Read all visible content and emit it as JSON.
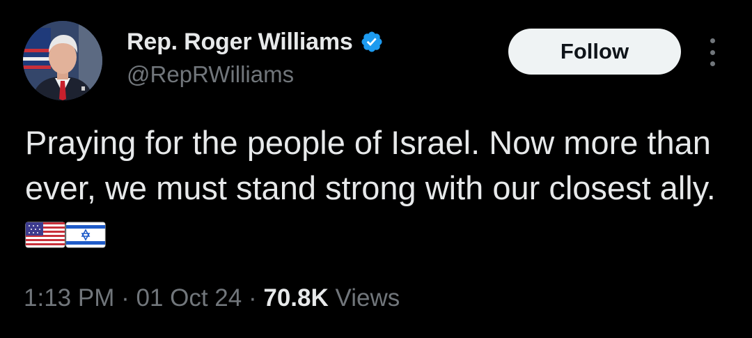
{
  "author": {
    "display_name": "Rep. Roger Williams",
    "handle": "@RepRWilliams",
    "verified_icon": "verified-badge-icon",
    "avatar_icon": "profile-photo"
  },
  "follow_button": {
    "label": "Follow"
  },
  "more_menu": {
    "icon": "more-vertical-icon"
  },
  "tweet": {
    "text": "Praying for the people of Israel. Now more than ever, we must stand strong with our closest ally.",
    "emojis": [
      "us-flag-icon",
      "israel-flag-icon"
    ]
  },
  "meta": {
    "time": "1:13 PM",
    "separator": "·",
    "date": "01 Oct 24",
    "views_count": "70.8K",
    "views_label": "Views"
  },
  "colors": {
    "background": "#000000",
    "primary_text": "#e7e9ea",
    "secondary_text": "#71767b",
    "follow_bg": "#eff3f4",
    "verified_blue": "#1d9bf0"
  }
}
